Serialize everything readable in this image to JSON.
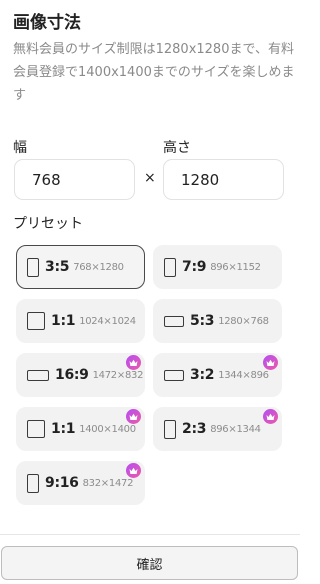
{
  "title": "画像寸法",
  "description": "無料会員のサイズ制限は1280x1280まで、有料会員登録で1400x1400までのサイズを楽しめます",
  "width": {
    "label": "幅",
    "value": "768"
  },
  "height": {
    "label": "高さ",
    "value": "1280"
  },
  "times_symbol": "×",
  "preset_label": "プリセット",
  "presets": [
    {
      "ratio": "3:5",
      "res": "768×1280",
      "shape": "portrait",
      "premium": false,
      "selected": true
    },
    {
      "ratio": "7:9",
      "res": "896×1152",
      "shape": "portrait",
      "premium": false,
      "selected": false
    },
    {
      "ratio": "1:1",
      "res": "1024×1024",
      "shape": "square",
      "premium": false,
      "selected": false
    },
    {
      "ratio": "5:3",
      "res": "1280×768",
      "shape": "landscape",
      "premium": false,
      "selected": false
    },
    {
      "ratio": "16:9",
      "res": "1472×832",
      "shape": "wide",
      "premium": true,
      "selected": false
    },
    {
      "ratio": "3:2",
      "res": "1344×896",
      "shape": "landscape",
      "premium": true,
      "selected": false
    },
    {
      "ratio": "1:1",
      "res": "1400×1400",
      "shape": "square",
      "premium": true,
      "selected": false
    },
    {
      "ratio": "2:3",
      "res": "896×1344",
      "shape": "portrait",
      "premium": true,
      "selected": false
    },
    {
      "ratio": "9:16",
      "res": "832×1472",
      "shape": "portrait",
      "premium": true,
      "selected": false
    }
  ],
  "premium_icon": "crown-icon",
  "accent_gradient": [
    "#b34df5",
    "#ee5aa7"
  ],
  "confirm_label": "確認"
}
